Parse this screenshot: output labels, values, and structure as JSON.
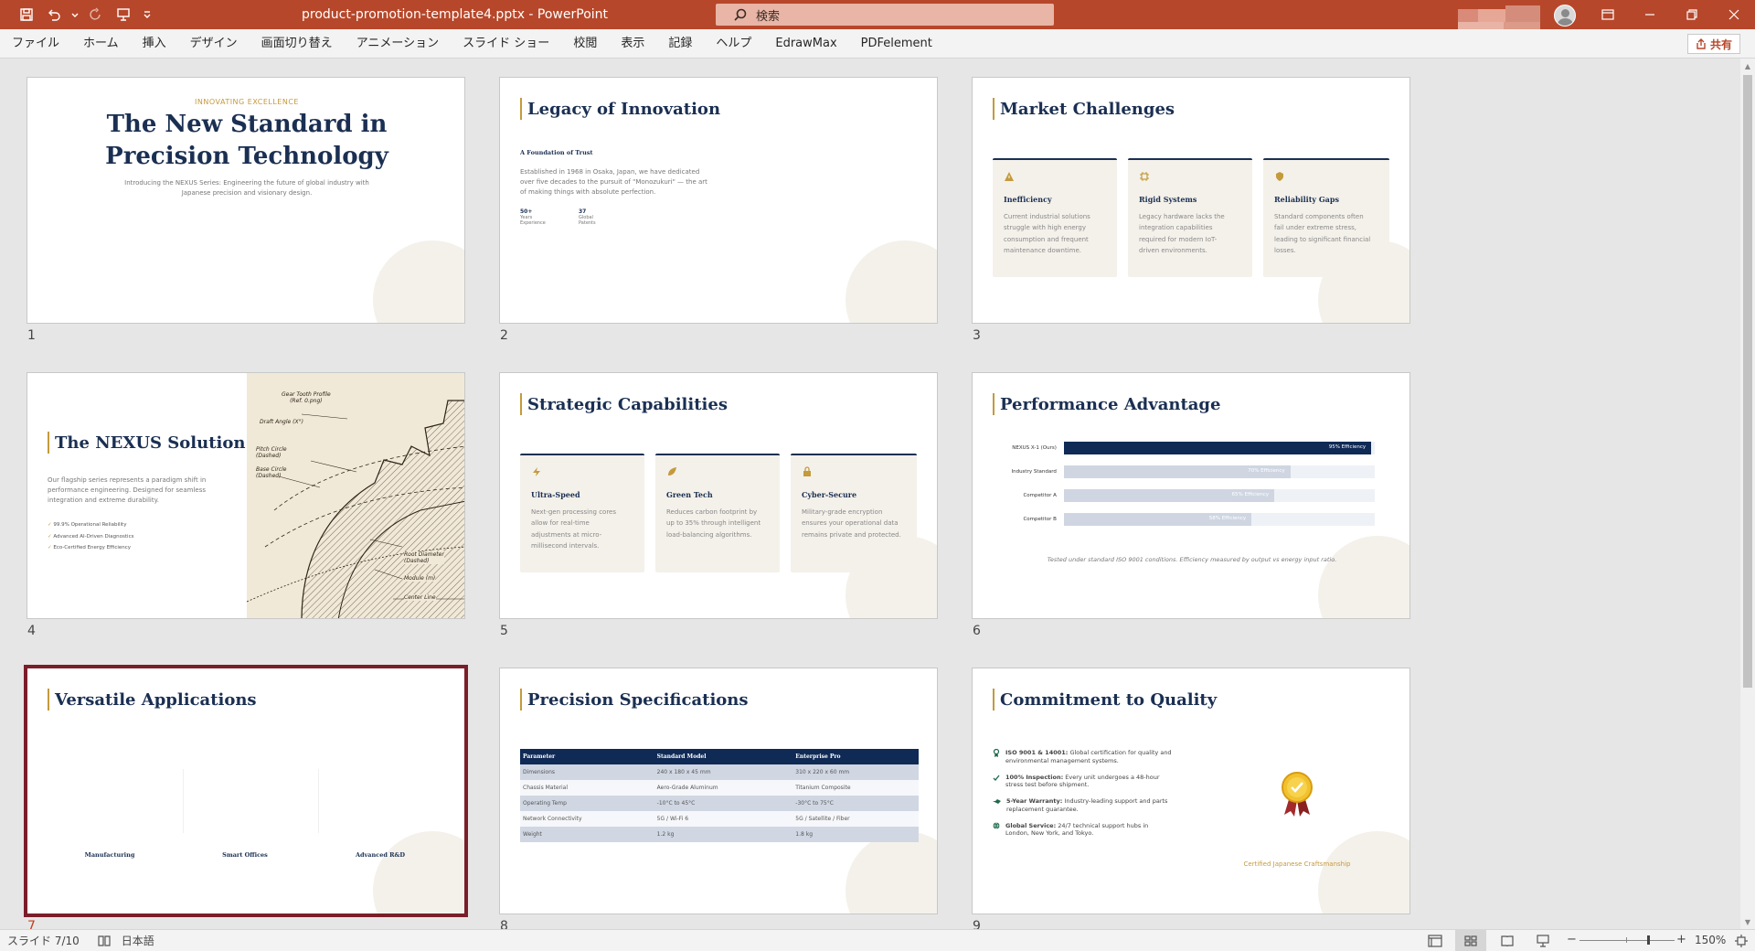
{
  "app": {
    "doc_title": "product-promotion-template4.pptx  -  PowerPoint",
    "search_placeholder": "検索",
    "share_label": "共有"
  },
  "ribbon": {
    "tabs": [
      "ファイル",
      "ホーム",
      "挿入",
      "デザイン",
      "画面切り替え",
      "アニメーション",
      "スライド ショー",
      "校閲",
      "表示",
      "記録",
      "ヘルプ",
      "EdrawMax",
      "PDFelement"
    ]
  },
  "slides": {
    "s1": {
      "num": "1",
      "eyebrow": "INNOVATING EXCELLENCE",
      "title_line1": "The New Standard in",
      "title_line2": "Precision Technology",
      "sub_line1": "Introducing the NEXUS Series: Engineering the future of global industry with",
      "sub_line2": "Japanese precision and visionary design."
    },
    "s2": {
      "num": "2",
      "title": "Legacy of Innovation",
      "kicker": "A Foundation of Trust",
      "body_line1": "Established in 1968 in Osaka, Japan, we have dedicated",
      "body_line2": "over five decades to the pursuit of \"Monozukuri\" — the art",
      "body_line3": "of making things with absolute perfection.",
      "stat1_value": "50+",
      "stat1_label1": "Years",
      "stat1_label2": "Experience",
      "stat2_value": "37",
      "stat2_label1": "Global",
      "stat2_label2": "Patents"
    },
    "s3": {
      "num": "3",
      "title": "Market Challenges",
      "cards": [
        {
          "title": "Inefficiency",
          "l1": "Current industrial solutions",
          "l2": "struggle with high energy",
          "l3": "consumption and frequent",
          "l4": "maintenance downtime."
        },
        {
          "title": "Rigid Systems",
          "l1": "Legacy hardware lacks the",
          "l2": "integration capabilities",
          "l3": "required for modern IoT-",
          "l4": "driven environments."
        },
        {
          "title": "Reliability Gaps",
          "l1": "Standard components often",
          "l2": "fail under extreme stress,",
          "l3": "leading to significant financial",
          "l4": "losses."
        }
      ]
    },
    "s4": {
      "num": "4",
      "title": "The NEXUS Solution",
      "body_line1": "Our flagship series represents a paradigm shift in",
      "body_line2": "performance engineering. Designed for seamless",
      "body_line3": "integration and extreme durability.",
      "checks": [
        "99.9% Operational Reliability",
        "Advanced AI-Driven Diagnostics",
        "Eco-Certified Energy Efficiency"
      ],
      "gear_labels": {
        "tooth_profile_1": "Gear Tooth Profile",
        "tooth_profile_2": "(Ref. 0.png)",
        "draft_angle": "Draft Angle (X°)",
        "pitch_circle_1": "Pitch Circle",
        "pitch_circle_2": "(Dashed)",
        "base_circle_1": "Base Circle",
        "base_circle_2": "(Dashed)",
        "root_diameter_1": "Root Diameter",
        "root_diameter_2": "(Dashed)",
        "module": "Module (m)",
        "center_line": "Center Line"
      }
    },
    "s5": {
      "num": "5",
      "title": "Strategic Capabilities",
      "cards": [
        {
          "title": "Ultra-Speed",
          "l1": "Next-gen processing cores",
          "l2": "allow for real-time",
          "l3": "adjustments at micro-",
          "l4": "millisecond intervals."
        },
        {
          "title": "Green Tech",
          "l1": "Reduces carbon footprint by",
          "l2": "up to 35% through intelligent",
          "l3": "load-balancing algorithms.",
          "l4": ""
        },
        {
          "title": "Cyber-Secure",
          "l1": "Military-grade encryption",
          "l2": "ensures your operational data",
          "l3": "remains private and protected.",
          "l4": ""
        }
      ]
    },
    "s6": {
      "num": "6",
      "title": "Performance Advantage",
      "bars": [
        {
          "label": "NEXUS X-1 (Ours)",
          "value_label": "95% Efficiency",
          "value": 0.95
        },
        {
          "label": "Industry Standard",
          "value_label": "70% Efficiency",
          "value": 0.7
        },
        {
          "label": "Competitor A",
          "value_label": "65% Efficiency",
          "value": 0.65
        },
        {
          "label": "Competitor B",
          "value_label": "58% Efficiency",
          "value": 0.58
        }
      ],
      "footnote": "Tested under standard ISO 9001 conditions. Efficiency measured by output vs energy input ratio."
    },
    "s7": {
      "num": "7",
      "title": "Versatile Applications",
      "labels": [
        "Manufacturing",
        "Smart Offices",
        "Advanced R&D"
      ]
    },
    "s8": {
      "num": "8",
      "title": "Precision Specifications",
      "headers": [
        "Parameter",
        "Standard Model",
        "Enterprise Pro"
      ],
      "rows": [
        [
          "Dimensions",
          "240 x 180 x 45 mm",
          "310 x 220 x 60 mm"
        ],
        [
          "Chassis Material",
          "Aero-Grade Aluminum",
          "Titanium Composite"
        ],
        [
          "Operating Temp",
          "-10°C to 45°C",
          "-30°C to 75°C"
        ],
        [
          "Network Connectivity",
          "5G / Wi-Fi 6",
          "5G / Satellite / Fiber"
        ],
        [
          "Weight",
          "1.2 kg",
          "1.8 kg"
        ]
      ]
    },
    "s9": {
      "num": "9",
      "title": "Commitment to Quality",
      "items": [
        {
          "bold": "ISO 9001 & 14001:",
          "l1": " Global certification for quality and",
          "l2": "environmental management systems."
        },
        {
          "bold": "100% Inspection:",
          "l1": " Every unit undergoes a 48-hour",
          "l2": "stress test before shipment."
        },
        {
          "bold": "5-Year Warranty:",
          "l1": " Industry-leading support and parts",
          "l2": "replacement guarantee."
        },
        {
          "bold": "Global Service:",
          "l1": " 24/7 technical support hubs in",
          "l2": "London, New York, and Tokyo."
        }
      ],
      "badge_caption": "Certified Japanese Craftsmanship"
    }
  },
  "status": {
    "slide_indicator": "スライド 7/10",
    "language": "日本語",
    "zoom": "150%"
  },
  "colors": {
    "brand": "#b7472a",
    "navy": "#1a2f52",
    "gold": "#c49a3c",
    "selection": "#7a1e2a"
  }
}
